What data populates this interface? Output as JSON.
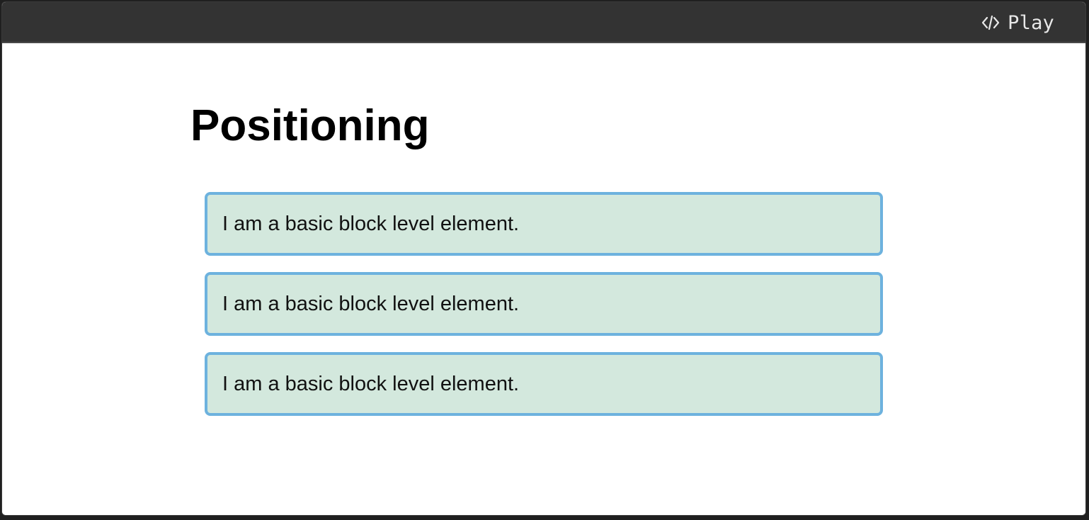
{
  "toolbar": {
    "play_label": "Play",
    "play_icon": "code-icon"
  },
  "main": {
    "title": "Positioning",
    "blocks": [
      {
        "text": "I am a basic block level element."
      },
      {
        "text": "I am a basic block level element."
      },
      {
        "text": "I am a basic block level element."
      }
    ]
  },
  "colors": {
    "topbar": "#333333",
    "block_background": "#d3e8dd",
    "block_border": "#6db2de"
  }
}
